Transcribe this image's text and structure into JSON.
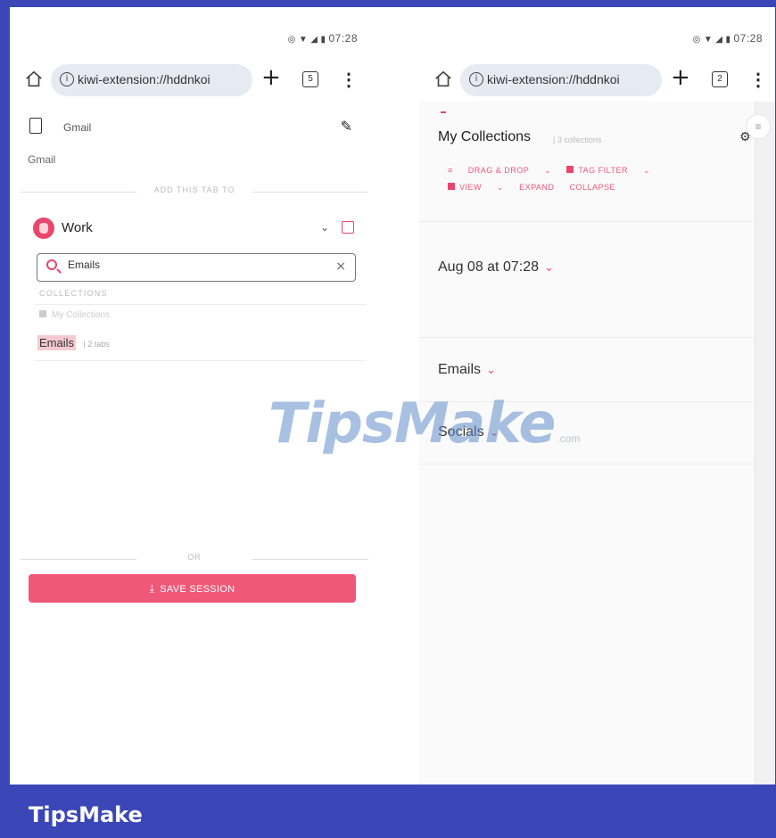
{
  "status": {
    "time": "07:28"
  },
  "left": {
    "url": "kiwi-extension://hddnkoi",
    "tab_count": "5",
    "tab_title": "Gmail",
    "tab_url": "Gmail",
    "add_this_tab_to": "ADD THIS TAB TO",
    "workspace": "Work",
    "search_value": "Emails",
    "collections_header": "COLLECTIONS",
    "disabled_row": "My Collections",
    "result_name": "Emails",
    "result_meta": "| 2 tabs",
    "or_label": "OR",
    "save_label": "SAVE SESSION"
  },
  "right": {
    "url": "kiwi-extension://hddnkoi",
    "tab_count": "2",
    "title": "My Collections",
    "count": "| 3 collections",
    "toolbar": {
      "drag_drop": "DRAG & DROP",
      "tag_filter": "TAG FILTER",
      "view": "VIEW",
      "expand": "EXPAND",
      "collapse": "COLLAPSE"
    },
    "groups": [
      "Aug 08 at 07:28",
      "Emails",
      "Socials"
    ]
  },
  "watermark": {
    "text": "TipsMake",
    "suffix": ".com"
  },
  "footer": {
    "brand": "TipsMake"
  },
  "colors": {
    "accent": "#ef5878",
    "frame": "#3b46b7"
  }
}
